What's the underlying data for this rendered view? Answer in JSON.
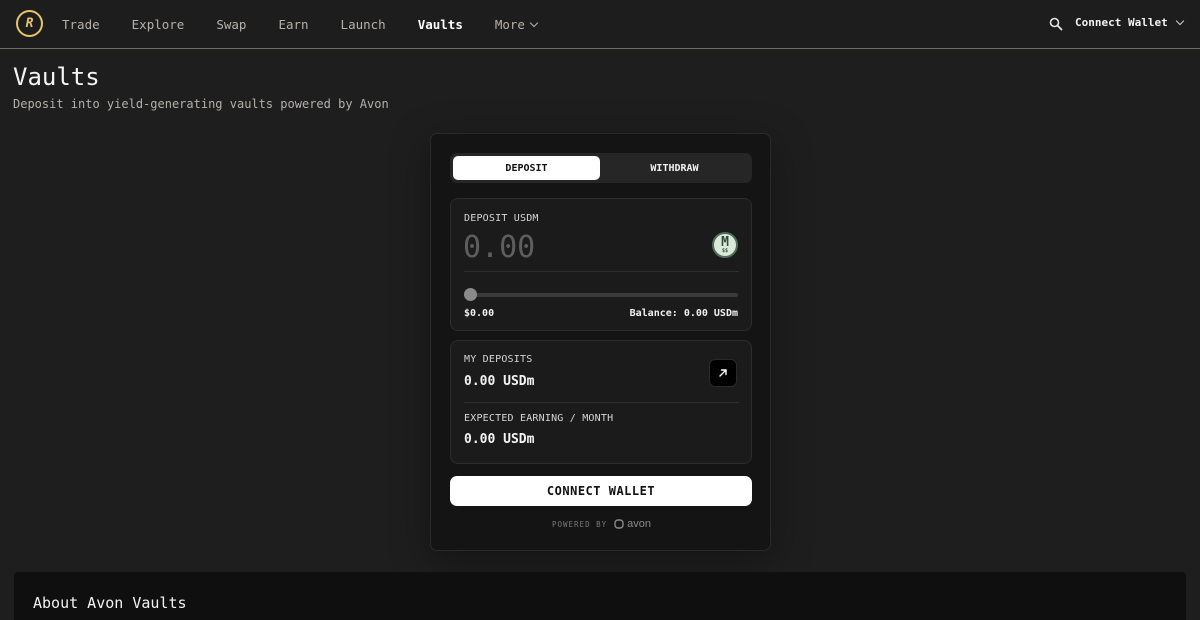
{
  "header": {
    "logo_letter": "R",
    "nav": [
      {
        "label": "Trade",
        "active": false
      },
      {
        "label": "Explore",
        "active": false
      },
      {
        "label": "Swap",
        "active": false
      },
      {
        "label": "Earn",
        "active": false
      },
      {
        "label": "Launch",
        "active": false
      },
      {
        "label": "Vaults",
        "active": true
      },
      {
        "label": "More",
        "active": false,
        "dropdown": true
      }
    ],
    "search_icon": "search-icon",
    "connect_wallet": "Connect Wallet",
    "accent": "#e7c46a"
  },
  "page": {
    "title": "Vaults",
    "subtitle": "Deposit into yield-generating vaults powered by Avon"
  },
  "vault_card": {
    "tabs": [
      {
        "label": "DEPOSIT",
        "selected": true
      },
      {
        "label": "WITHDRAW",
        "selected": false
      }
    ],
    "deposit": {
      "label": "DEPOSIT USDM",
      "amount_placeholder": "0.00",
      "amount_value": "",
      "token_icon": "usdm-token-icon",
      "token_letter": "M",
      "token_sub": "$$",
      "slider_fraction": 0,
      "usd_value": "$0.00",
      "balance_label": "Balance:",
      "balance_value": "0.00 USDm"
    },
    "stats": {
      "my_deposits_label": "MY DEPOSITS",
      "my_deposits_value": "0.00 USDm",
      "expected_label": "EXPECTED EARNING / MONTH",
      "expected_value": "0.00 USDm",
      "arrow_icon": "arrow-up-right-icon"
    },
    "connect_button": "CONNECT WALLET",
    "powered_by": "POWERED BY",
    "powered_brand": "avon"
  },
  "about": {
    "title": "About Avon Vaults"
  }
}
